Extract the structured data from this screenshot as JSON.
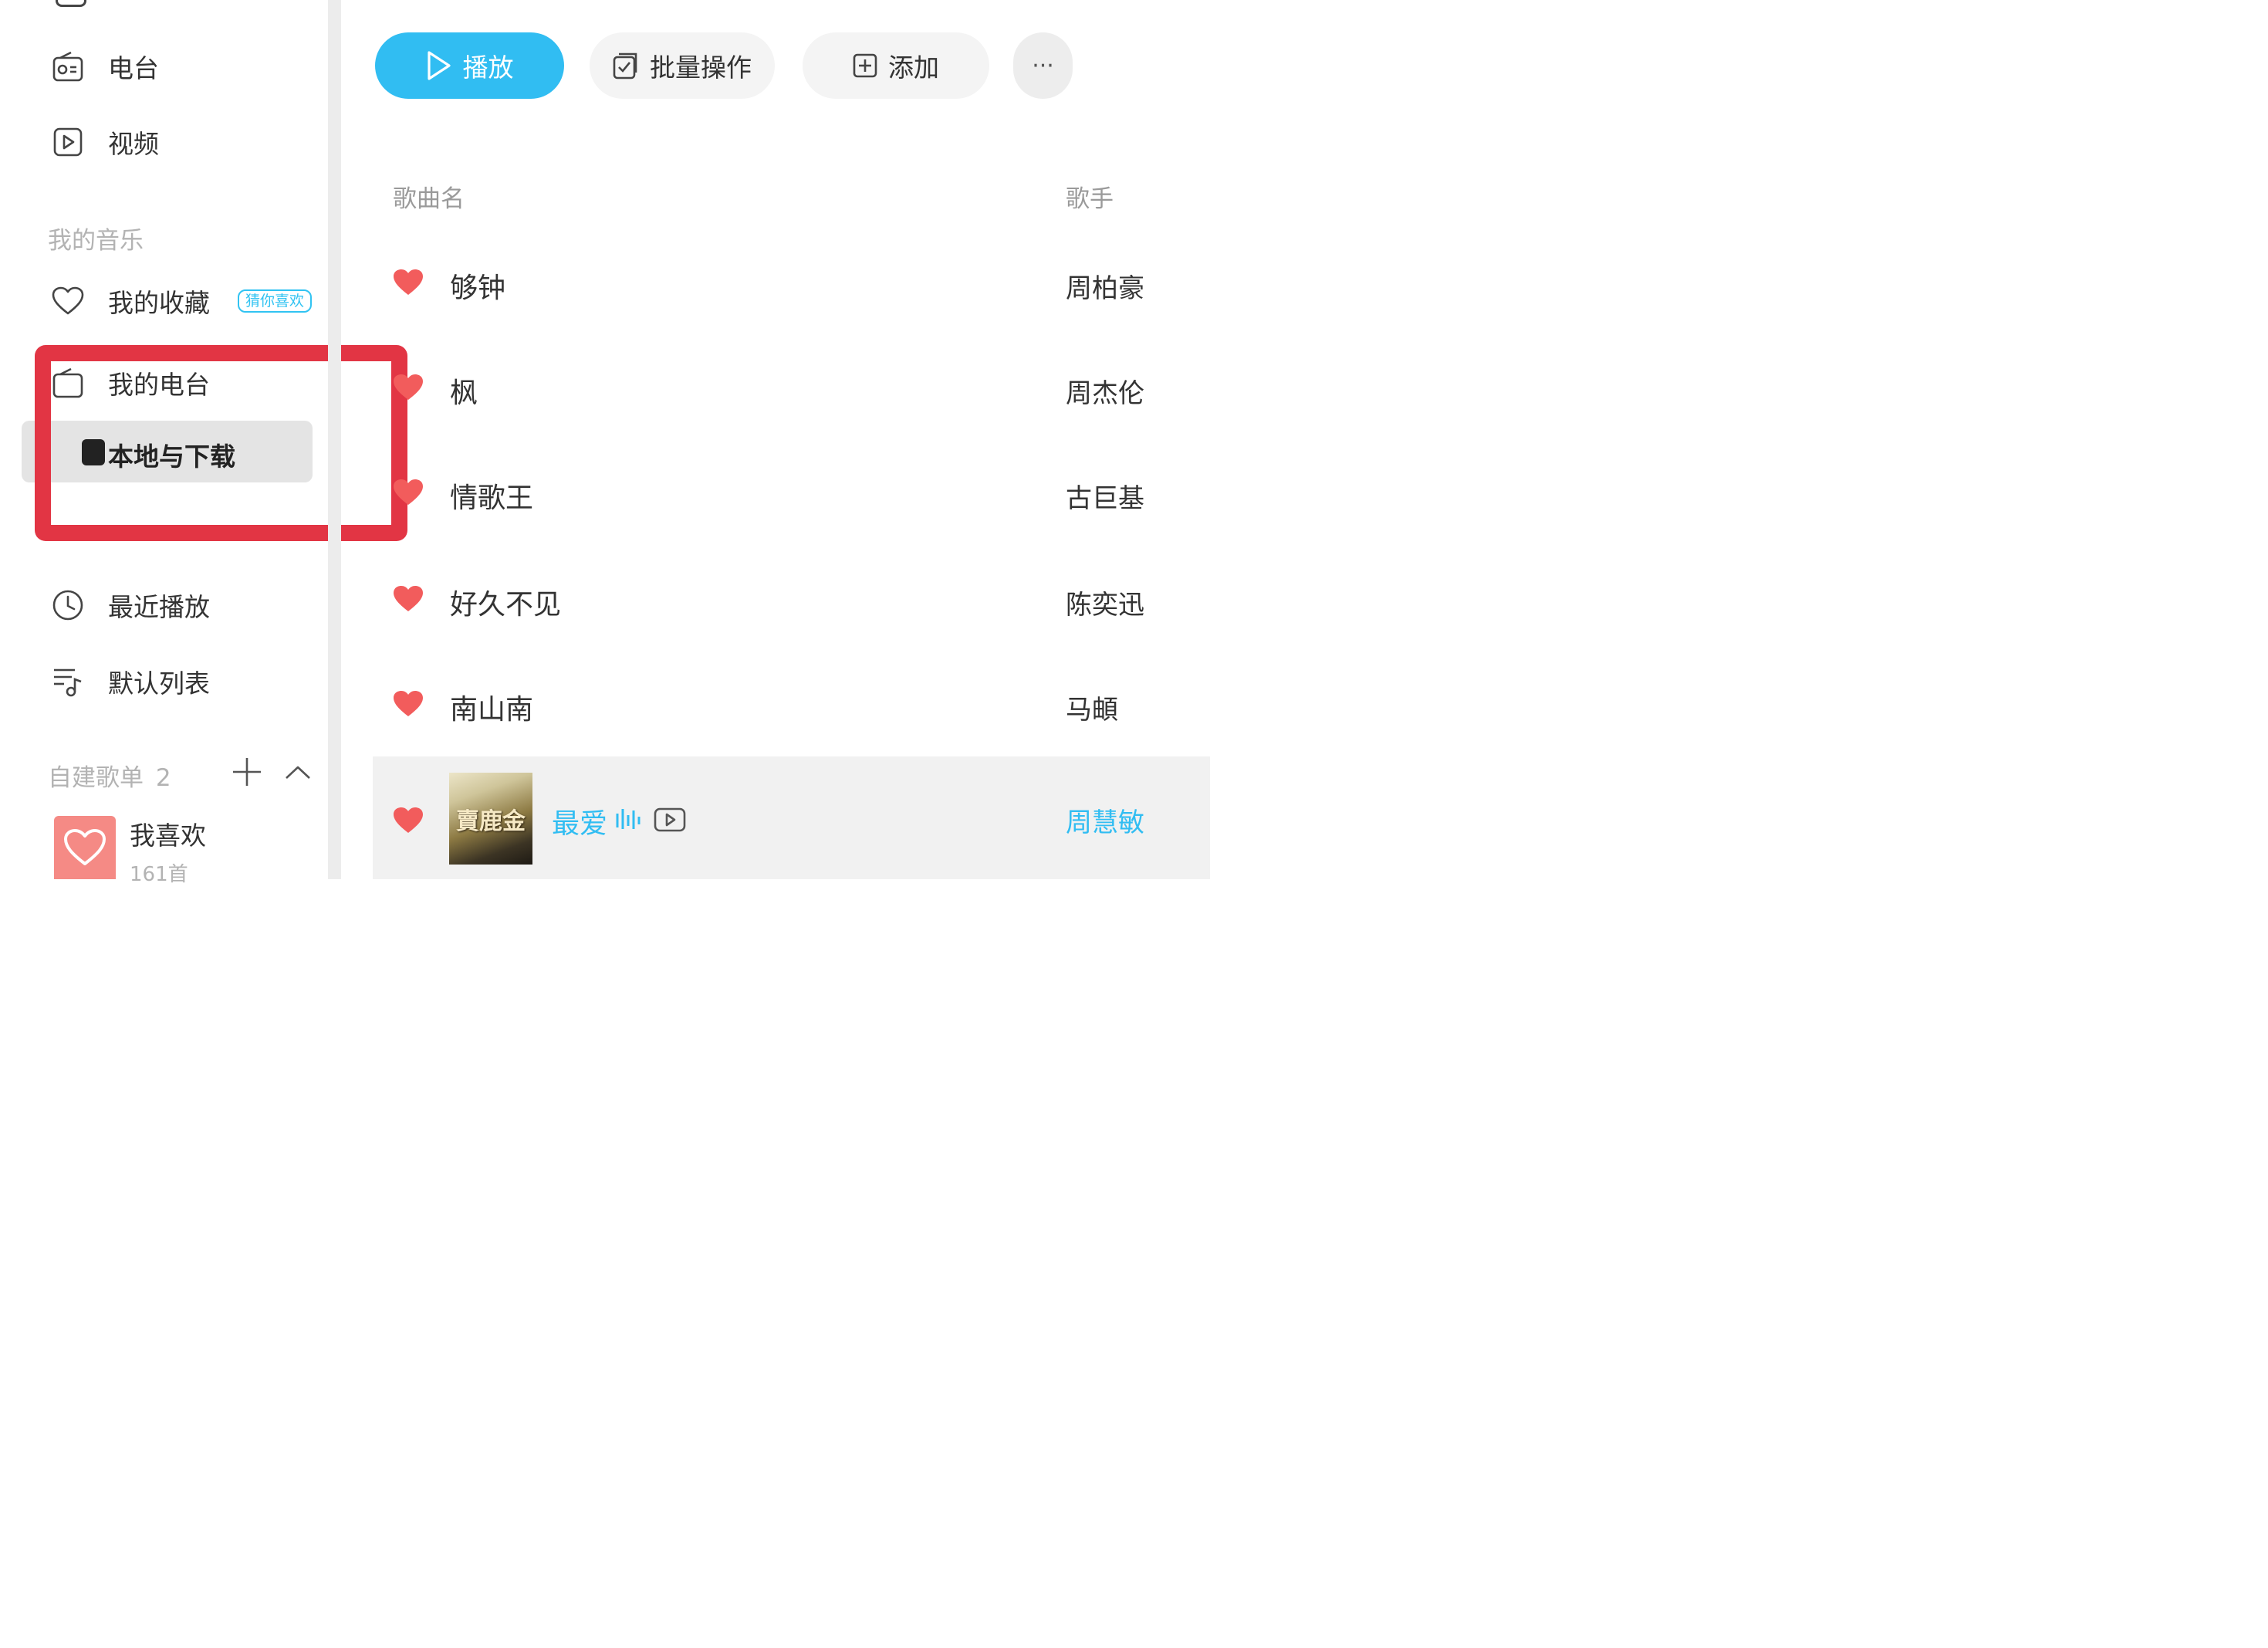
{
  "sidebar": {
    "nav": [
      {
        "label": "电台",
        "icon": "radio-icon"
      },
      {
        "label": "视频",
        "icon": "video-icon"
      }
    ],
    "my_music_title": "我的音乐",
    "my_music": {
      "favorites": {
        "label": "我的收藏",
        "badge": "猜你喜欢",
        "icon": "heart-outline-icon"
      },
      "my_radio": {
        "label": "我的电台",
        "icon": "radio-icon"
      },
      "local": {
        "label": "本地与下载",
        "icon": "download-icon"
      },
      "recent": {
        "label": "最近播放",
        "icon": "clock-icon"
      },
      "default_list": {
        "label": "默认列表",
        "icon": "playlist-icon"
      }
    },
    "playlists": {
      "title": "自建歌单",
      "count": "2",
      "items": [
        {
          "name": "我喜欢",
          "count": "161首",
          "icon": "heart-icon"
        }
      ]
    }
  },
  "toolbar": {
    "play_label": "播放",
    "batch_label": "批量操作",
    "add_label": "添加",
    "more_label": "···"
  },
  "table": {
    "columns": {
      "title": "歌曲名",
      "artist": "歌手"
    },
    "rows": [
      {
        "title": "够钟",
        "artist": "周柏豪",
        "liked": true
      },
      {
        "title": "枫",
        "artist": "周杰伦",
        "liked": true
      },
      {
        "title": "情歌王",
        "artist": "古巨基",
        "liked": true
      },
      {
        "title": "好久不见",
        "artist": "陈奕迅",
        "liked": true
      },
      {
        "title": "南山南",
        "artist": "马頔",
        "liked": true
      },
      {
        "title": "最爱",
        "artist": "周慧敏",
        "liked": true,
        "playing": true,
        "cover_text": "賣鹿金"
      }
    ]
  },
  "colors": {
    "accent": "#31bdf2",
    "heart": "#f25c5c",
    "highlight_box": "#e23544"
  }
}
